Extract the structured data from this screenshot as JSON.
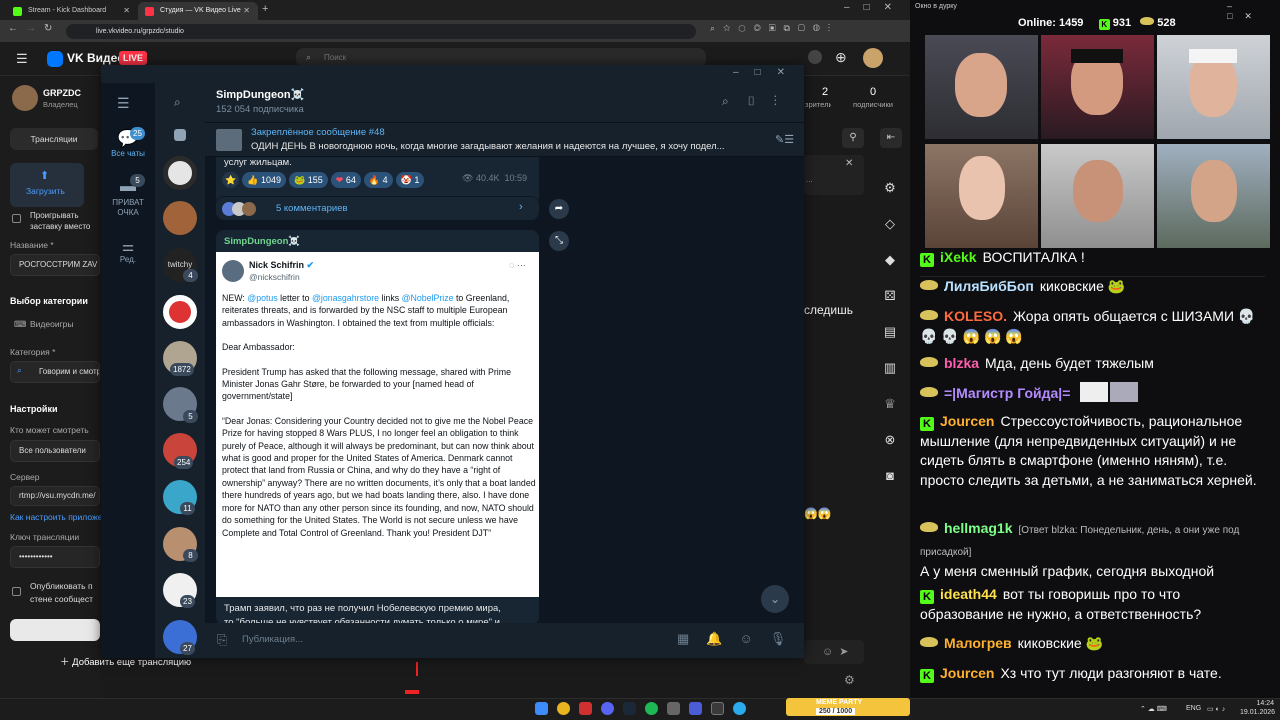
{
  "browser": {
    "tabs": [
      {
        "label": "Stream - Kick Dashboard"
      },
      {
        "label": "Студия — VK Видео Live"
      }
    ],
    "url": "live.vkvideo.ru/grpzdc/studio"
  },
  "vk": {
    "logo_text": "VK Видео",
    "live_badge": "LIVE",
    "search_placeholder": "Поиск",
    "channel_name": "GRPZDC",
    "channel_role": "Владелец",
    "nav_streams": "Трансляции",
    "upload_label": "Загрузить",
    "replay_label": "Проигрывать заставку вместо обложки",
    "name_label": "Название *",
    "name_value": "РОСГОССТРИМ ZAV",
    "category_section": "Выбор категории",
    "category_videogames": "Видеоигры",
    "category_label": "Категория *",
    "category_value": "Говорим и смотр",
    "settings_head": "Настройки",
    "who_can_watch": "Кто может смотреть",
    "who_value": "Все пользователи",
    "server_label": "Сервер",
    "server_value": "rtmp://vsu.mycdn.me/",
    "howto_link": "Как настроить приложе",
    "key_label": "Ключ трансляции",
    "key_value": "••••••••••••",
    "publish_label": "Опубликовать п стене сообщест",
    "add_stream": "Добавить еще трансляцию",
    "stats": [
      {
        "value": "2",
        "label": "зрители"
      },
      {
        "value": "0",
        "label": "подписчики"
      }
    ],
    "partial_text_1": "следишь",
    "partial_text_2": "..."
  },
  "telegram": {
    "folders": [
      {
        "label": "Все чаты",
        "badge": "25"
      },
      {
        "label": "ПРИВАТ ОЧКА",
        "badge": "5"
      },
      {
        "label": "Ред.",
        "badge": ""
      }
    ],
    "chat_badges": [
      "",
      "",
      "4",
      "",
      "1872",
      "5",
      "254",
      "11",
      "8",
      "23",
      "27"
    ],
    "chat_name": "SimpDungeon☠️",
    "subscribers": "152 054 подписчика",
    "pinned_title": "Закреплённое сообщение #48",
    "pinned_text": "ОДИН ДЕНЬ  В новогоднюю ночь, когда многие загадывают желания и надеются на лучшее, я хочу подел...",
    "prev_text": "услуг жильцам.",
    "reactions": [
      {
        "emoji": "👍",
        "count": "1049"
      },
      {
        "emoji": "🐸",
        "count": "155"
      },
      {
        "emoji": "❤",
        "count": "64"
      },
      {
        "emoji": "🔥",
        "count": "4"
      },
      {
        "emoji": "🤡",
        "count": "1"
      }
    ],
    "views": "40.4K",
    "time": "10:59",
    "comments": "5 комментариев",
    "post_author": "SimpDungeon☠️",
    "tweet": {
      "name": "Nick Schifrin",
      "handle": "@nickschifrin",
      "p1_a": "NEW: ",
      "p1_m1": "@potus",
      "p1_b": " letter to ",
      "p1_m2": "@jonasgahrstore",
      "p1_c": " links ",
      "p1_m3": "@NobelPrize",
      "p1_d": " to Greenland, reiterates threats, and is forwarded by the NSC staff to multiple European ambassadors in Washington. I obtained the text from multiple officials:",
      "p2": "Dear Ambassador:",
      "p3": "President Trump has asked that the following message, shared with Prime Minister Jonas Gahr Støre, be forwarded to your [named head of government/state]",
      "p4": "“Dear Jonas: Considering your Country decided not to give me the Nobel Peace Prize for having stopped 8 Wars PLUS, I no longer feel an obligation to think purely of Peace, although it will always be predominant, but can now think about what is good and proper for the United States of America. Denmark cannot protect that land from Russia or China, and why do they have a “right of ownership” anyway? There are no written documents, it’s only that a boat landed there hundreds of years ago, but we had boats landing there, also. I have done more for NATO than any other person since its founding, and now, NATO should do something for the United States. The World is not secure unless we have Complete and Total Control of Greenland. Thank you! President DJT”"
    },
    "caption_line1": "Трамп заявил, что раз не получил Нобелевскую премию мира,",
    "caption_line2": "то \"больше не чувствует обязанности думать только о мире\" и",
    "input_placeholder": "Публикация..."
  },
  "stream": {
    "window_title": "Окно в дурку",
    "online_label": "Online:",
    "online_count": "1459",
    "kick_count": "931",
    "vk_count": "528",
    "messages": [
      {
        "platform": "kick",
        "user": "iXekk",
        "color": "#53fc18",
        "text": "ВОСПИТАЛКА !"
      },
      {
        "platform": "vk",
        "user": "ЛиляБибБоп",
        "color": "#b9e0ff",
        "text": "киковские 🐸"
      },
      {
        "platform": "vk",
        "user": "KOLESO.",
        "color": "#ff6b3d",
        "text": "Жора опять общается с ШИЗАМИ 💀 💀 💀 😱 😱 😱"
      },
      {
        "platform": "vk",
        "user": "blzka",
        "color": "#ff5fb0",
        "text": "Мда, день будет тяжелым"
      },
      {
        "platform": "vk",
        "user": "=|Магистр Гойда|=",
        "color": "#b58cff",
        "text": ""
      },
      {
        "platform": "kick",
        "user": "Jourcen",
        "color": "#ffb02e",
        "text": "Стрессоустойчивость, рациональное мышление (для непредвиденных ситуаций) и не сидеть блять в смартфоне (именно няням), т.е. просто следить за детьми, а не заниматься херней."
      },
      {
        "platform": "vk",
        "user": "hellmag1k",
        "color": "#7dff8a",
        "reply": "[Ответ blzka: Понедельник, день, а они уже под присадкой]",
        "text": "А у меня сменный график, сегодня выходной"
      },
      {
        "platform": "kick",
        "user": "ideath44",
        "color": "#ffe14d",
        "text": "вот ты говоришь про то что образование не нужно, а ответственность?"
      },
      {
        "platform": "vk",
        "user": "Малогрев",
        "color": "#ffb02e",
        "text": "киковские 🐸"
      },
      {
        "platform": "kick",
        "user": "Jourcen",
        "color": "#ffb02e",
        "text": "Хз что тут люди разгоняют в чате."
      }
    ]
  },
  "taskbar": {
    "widget": "MEME PARTY",
    "widget_count": "250 / 1000",
    "lang": "ENG",
    "time": "14:24",
    "date": "19.01.2026"
  }
}
